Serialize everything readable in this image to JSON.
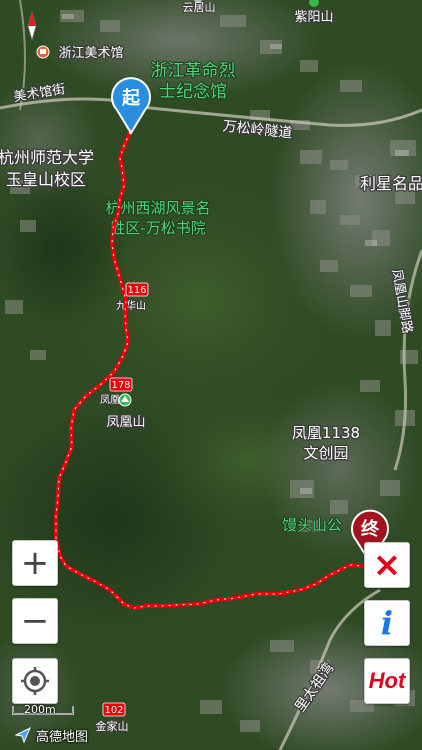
{
  "map": {
    "labels": {
      "yunjushan": "云居山",
      "ziyangshan": "紫阳山",
      "zhejiang_art_museum": "浙江美术馆",
      "meishuguan_street": "美术馆街",
      "martyrs_memorial_line1": "浙江革命烈",
      "martyrs_memorial_line2": "士纪念馆",
      "wansongling_tunnel": "万松岭隧道",
      "normal_univ_line1": "杭州师范大学",
      "normal_univ_line2": "玉皇山校区",
      "lixing": "利星名品",
      "scenic_area_line1": "杭州西湖风景名",
      "scenic_area_line2": "胜区-万松书院",
      "fenghuangshan_road": "凤凰山脚路",
      "jiuhuashan": "九华山",
      "fenghuang_peak_small": "凤凰",
      "fenghuangshan": "凤凰山",
      "park1138_line1": "凤凰1138",
      "park1138_line2": "文创园",
      "mantoushan": "馒头山公",
      "lidaxiangwan": "里太祖湾",
      "jinjiashan": "金家山"
    },
    "route_markers": {
      "marker_116": "116",
      "marker_178": "178",
      "marker_102": "102"
    },
    "start_pin": "起",
    "end_pin": "终",
    "scale": "200m",
    "logo": "高德地图",
    "colors": {
      "route": "#e8000b",
      "start_pin": "#2a8ee0",
      "end_pin": "#a3121f"
    }
  },
  "controls": {
    "zoom_in": "+",
    "zoom_out": "−",
    "close": "×",
    "info": "i",
    "hot": "Hot"
  }
}
